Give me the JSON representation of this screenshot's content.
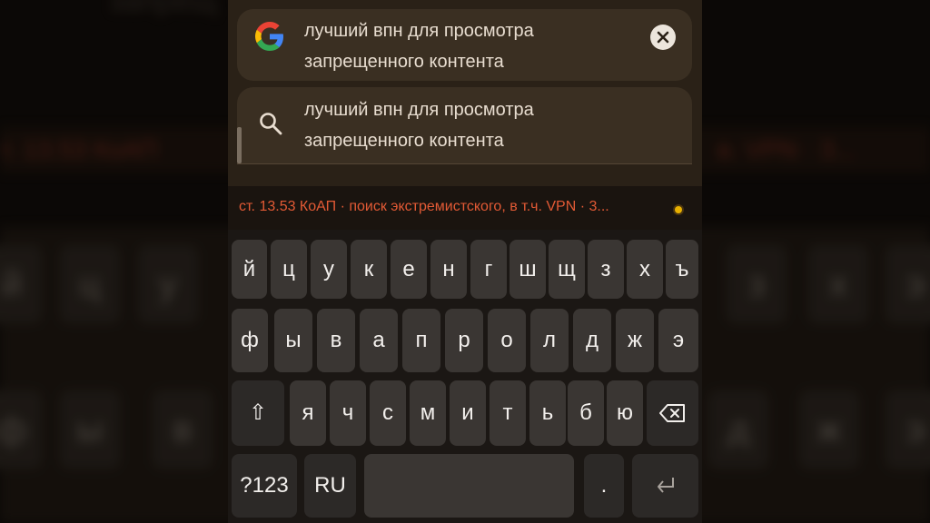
{
  "background": {
    "top_text": "запрещ",
    "warning_left": "т. 13.53 КоАП",
    "warning_right": "в. VPN · 3...",
    "keys_left": [
      "й",
      "ц",
      "у",
      "ф",
      "ы",
      "в"
    ],
    "keys_right": [
      "з",
      "х",
      "э",
      "д",
      "ж",
      "э"
    ]
  },
  "suggestions": [
    {
      "icon": "google-g-icon",
      "line1": "лучший впн для просмотра",
      "line2": "запрещенного контента",
      "action_icon": "close-icon"
    },
    {
      "icon": "search-icon",
      "line1": "лучший впн для просмотра",
      "line2": "запрещенного контента"
    }
  ],
  "ticker": {
    "text": "ст. 13.53 КоАП · поиск экстремистского, в т.ч. VPN · 3...",
    "color": "#e35a35"
  },
  "keyboard": {
    "row1": [
      "й",
      "ц",
      "у",
      "к",
      "е",
      "н",
      "г",
      "ш",
      "щ",
      "з",
      "х",
      "ъ"
    ],
    "row2": [
      "ф",
      "ы",
      "в",
      "а",
      "п",
      "р",
      "о",
      "л",
      "д",
      "ж",
      "э"
    ],
    "row3": [
      "я",
      "ч",
      "с",
      "м",
      "и",
      "т",
      "ь",
      "б",
      "ю"
    ],
    "shift": "⇧",
    "backspace_icon": "backspace-icon",
    "symbols": "?123",
    "language": "RU",
    "period": ".",
    "enter_icon": "enter-icon"
  },
  "colors": {
    "warning": "#e35a35",
    "card": "#3a2f22",
    "key": "#3a3633"
  }
}
